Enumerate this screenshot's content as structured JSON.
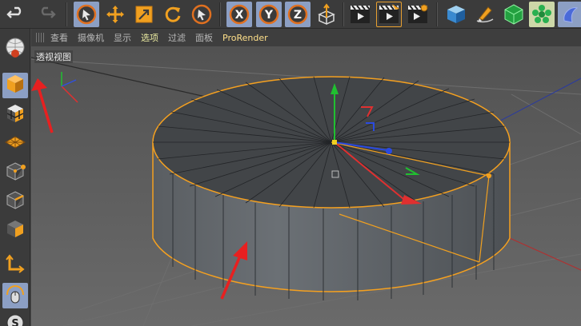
{
  "viewport": {
    "menu": [
      "查看",
      "摄像机",
      "显示",
      "选项",
      "过滤",
      "面板",
      "ProRender"
    ],
    "active_menu": "选项",
    "view_label": "透视视图"
  },
  "icons": {
    "toolbar": [
      "undo-icon",
      "redo-icon",
      "select-arrow-icon",
      "move-icon",
      "scale-icon",
      "rotate-icon",
      "live-select-icon",
      "x-axis-icon",
      "y-axis-icon",
      "z-axis-icon",
      "coordinate-system-icon",
      "render-view-icon",
      "render-to-picture-viewer-icon",
      "render-settings-icon",
      "cube-icon",
      "pen-icon",
      "subdivision-icon",
      "cloner-icon",
      "deformer-icon"
    ],
    "left": [
      "make-editable-icon",
      "model-mode-icon",
      "texture-mode-icon",
      "workplane-icon",
      "points-mode-icon",
      "edges-mode-icon",
      "polygons-mode-icon",
      "axis-mode-icon",
      "tweak-mode-icon",
      "snap-icon"
    ]
  },
  "colors": {
    "accent_orange": "#f0a020",
    "x_axis": "#e03030",
    "y_axis": "#20c030",
    "z_axis": "#2a4ae0",
    "annotation_arrow": "#e82020",
    "selection_outline": "#f4a020"
  }
}
